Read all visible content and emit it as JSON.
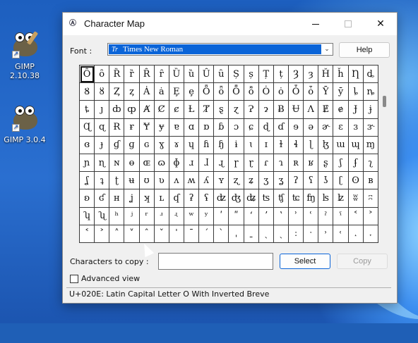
{
  "desktop": {
    "icons": [
      {
        "label": "GIMP 2.10.38",
        "icon": "gimp-icon"
      },
      {
        "label": "GIMP 3.0.4",
        "icon": "gimp-icon"
      }
    ]
  },
  "window": {
    "title": "Character Map",
    "buttons": {
      "minimize": "minimize-icon",
      "maximize": "maximize-icon",
      "close": "✕"
    }
  },
  "font": {
    "label": "Font :",
    "selected": "Times New Roman",
    "type_badge": "Tr"
  },
  "help_label": "Help",
  "grid": {
    "rows": [
      [
        "Ȏ",
        "ȏ",
        "Ȑ",
        "ȑ",
        "Ȓ",
        "ȓ",
        "Ȕ",
        "ȕ",
        "Ȗ",
        "ȗ",
        "Ș",
        "ș",
        "Ț",
        "ț",
        "Ȝ",
        "ȝ",
        "Ȟ",
        "ȟ",
        "Ƞ",
        "ȡ"
      ],
      [
        "Ȣ",
        "ȣ",
        "Ȥ",
        "ȥ",
        "Ȧ",
        "ȧ",
        "Ȩ",
        "ȩ",
        "Ȫ",
        "ȫ",
        "Ȭ",
        "ȭ",
        "Ȯ",
        "ȯ",
        "Ȱ",
        "ȱ",
        "Ȳ",
        "ȳ",
        "ȴ",
        "ȵ"
      ],
      [
        "ȶ",
        "ȷ",
        "ȸ",
        "ȹ",
        "Ⱥ",
        "Ȼ",
        "ȼ",
        "Ƚ",
        "Ⱦ",
        "ȿ",
        "ɀ",
        "Ɂ",
        "ɂ",
        "Ƀ",
        "Ʉ",
        "Ʌ",
        "Ɇ",
        "ɇ",
        "Ɉ",
        "ɉ"
      ],
      [
        "Ɋ",
        "ɋ",
        "Ɍ",
        "ɍ",
        "Ɏ",
        "ɏ",
        "ɐ",
        "ɑ",
        "ɒ",
        "ɓ",
        "ɔ",
        "ɕ",
        "ɖ",
        "ɗ",
        "ɘ",
        "ə",
        "ɚ",
        "ɛ",
        "ɜ",
        "ɝ"
      ],
      [
        "ɞ",
        "ɟ",
        "ɠ",
        "ɡ",
        "ɢ",
        "ɣ",
        "ɤ",
        "ɥ",
        "ɦ",
        "ɧ",
        "ɨ",
        "ɩ",
        "ɪ",
        "ɫ",
        "ɬ",
        "ɭ",
        "ɮ",
        "ɯ",
        "ɰ",
        "ɱ"
      ],
      [
        "ɲ",
        "ɳ",
        "ɴ",
        "ɵ",
        "ɶ",
        "ɷ",
        "ɸ",
        "ɹ",
        "ɺ",
        "ɻ",
        "ɼ",
        "ɽ",
        "ɾ",
        "ɿ",
        "ʀ",
        "ʁ",
        "ʂ",
        "ʃ",
        "ʄ",
        "ʅ"
      ],
      [
        "ʆ",
        "ʇ",
        "ʈ",
        "ʉ",
        "ʊ",
        "ʋ",
        "ʌ",
        "ʍ",
        "ʎ",
        "ʏ",
        "ʐ",
        "ʑ",
        "ʒ",
        "ʓ",
        "ʔ",
        "ʕ",
        "ʖ",
        "ʗ",
        "ʘ",
        "ʙ"
      ],
      [
        "ʚ",
        "ʛ",
        "ʜ",
        "ʝ",
        "ʞ",
        "ʟ",
        "ʠ",
        "ʡ",
        "ʢ",
        "ʣ",
        "ʤ",
        "ʥ",
        "ʦ",
        "ʧ",
        "ʨ",
        "ʩ",
        "ʪ",
        "ʫ",
        "ʬ",
        "ʭ"
      ],
      [
        "ʮ",
        "ʯ",
        "ʰ",
        "ʲ",
        "ʳ",
        "ʴ",
        "ʵ",
        "ʷ",
        "ʸ",
        "ʹ",
        "ʺ",
        "ʻ",
        "ʼ",
        "ʽ",
        "ʾ",
        "ʿ",
        "ˀ",
        "ˁ",
        "˂",
        "˃"
      ],
      [
        "˂",
        "˃",
        "˄",
        "˅",
        "ˆ",
        "ˇ",
        "ˈ",
        "ˉ",
        "ˊ",
        "ˋ",
        "ˌ",
        "ˍ",
        "ˎ",
        "ˏ",
        "ː",
        "ˑ",
        "˒",
        "˓",
        "˔",
        "˕"
      ]
    ],
    "selected_row": 0,
    "selected_col": 0
  },
  "copy": {
    "label": "Characters to copy :",
    "value": "",
    "select_label": "Select",
    "copy_label": "Copy"
  },
  "advanced_label": "Advanced view",
  "status": "U+020E: Latin Capital Letter O With Inverted Breve"
}
